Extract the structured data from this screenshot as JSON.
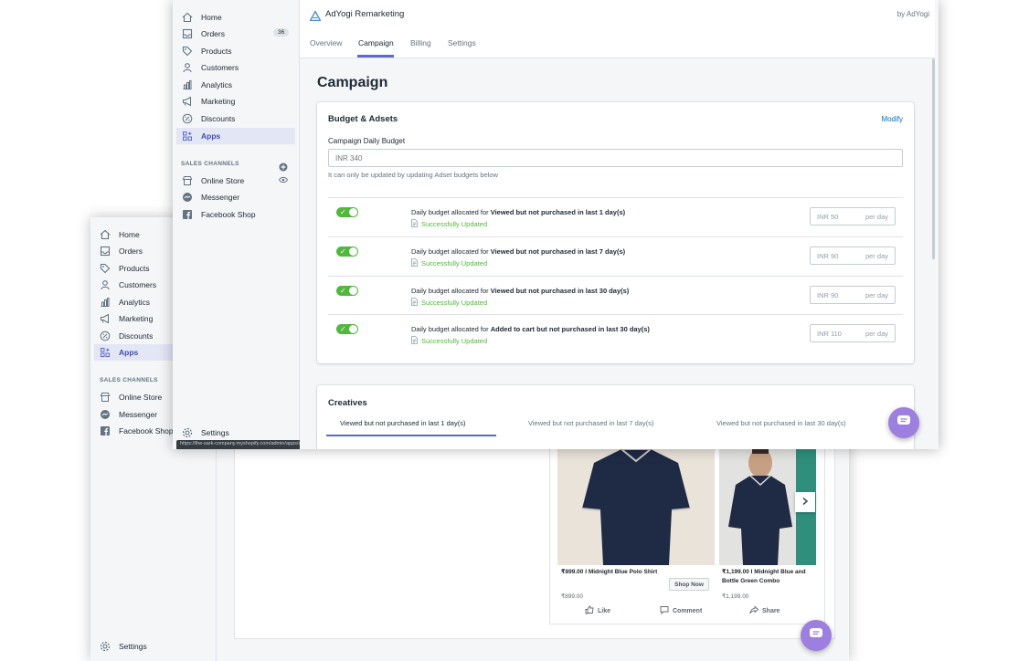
{
  "colors": {
    "accent": "#5c6ac4",
    "toggle_on": "#50b83c",
    "chat_fab": "#9d7fe0",
    "link": "#006fbb"
  },
  "back_window": {
    "sidebar": {
      "items": [
        {
          "label": "Home",
          "icon": "home-icon"
        },
        {
          "label": "Orders",
          "icon": "orders-icon"
        },
        {
          "label": "Products",
          "icon": "tag-icon"
        },
        {
          "label": "Customers",
          "icon": "person-icon"
        },
        {
          "label": "Analytics",
          "icon": "bar-chart-icon"
        },
        {
          "label": "Marketing",
          "icon": "megaphone-icon"
        },
        {
          "label": "Discounts",
          "icon": "discount-icon"
        },
        {
          "label": "Apps",
          "icon": "apps-icon",
          "active": true
        }
      ],
      "sales_channels_label": "SALES CHANNELS",
      "channels": [
        {
          "label": "Online Store",
          "icon": "store-icon"
        },
        {
          "label": "Messenger",
          "icon": "messenger-icon"
        },
        {
          "label": "Facebook Shop",
          "icon": "facebook-icon"
        }
      ],
      "settings_label": "Settings"
    },
    "fb_post": {
      "products": [
        {
          "name": "₹899.00 I Midnight Blue Polo Shirt",
          "price": "₹899.00",
          "cta": "Shop Now"
        },
        {
          "name": "₹1,199.00 I Midnight Blue and Bottle Green Combo",
          "price": "₹1,199.00"
        }
      ],
      "actions": {
        "like": "Like",
        "comment": "Comment",
        "share": "Share"
      }
    }
  },
  "front_window": {
    "sidebar": {
      "items": [
        {
          "label": "Home",
          "icon": "home-icon"
        },
        {
          "label": "Orders",
          "icon": "orders-icon",
          "badge": "36"
        },
        {
          "label": "Products",
          "icon": "tag-icon"
        },
        {
          "label": "Customers",
          "icon": "person-icon"
        },
        {
          "label": "Analytics",
          "icon": "bar-chart-icon"
        },
        {
          "label": "Marketing",
          "icon": "megaphone-icon"
        },
        {
          "label": "Discounts",
          "icon": "discount-icon"
        },
        {
          "label": "Apps",
          "icon": "apps-icon",
          "active": true
        }
      ],
      "sales_channels_label": "SALES CHANNELS",
      "channels": [
        {
          "label": "Online Store",
          "icon": "store-icon"
        },
        {
          "label": "Messenger",
          "icon": "messenger-icon"
        },
        {
          "label": "Facebook Shop",
          "icon": "facebook-icon"
        }
      ],
      "settings_label": "Settings"
    },
    "header": {
      "app_name": "AdYogi Remarketing",
      "by_line": "by AdYogi",
      "tabs": [
        "Overview",
        "Campaign",
        "Billing",
        "Settings"
      ],
      "active_tab": "Campaign"
    },
    "page_title": "Campaign",
    "budget_card": {
      "title": "Budget & Adsets",
      "modify_label": "Modify",
      "daily_budget_label": "Campaign Daily Budget",
      "daily_budget_placeholder": "INR 340",
      "help_text": "It can only be updated by updating Adset budgets below",
      "rows": [
        {
          "prefix": "Daily budget allocated for ",
          "segment": "Viewed but not purchased in last 1 day(s)",
          "status": "Successfully Updated",
          "amount": "INR 50",
          "suffix": "per day",
          "enabled": true
        },
        {
          "prefix": "Daily budget allocated for ",
          "segment": "Viewed but not purchased in last 7 day(s)",
          "status": "Successfully Updated",
          "amount": "INR 90",
          "suffix": "per day",
          "enabled": true
        },
        {
          "prefix": "Daily budget allocated for ",
          "segment": "Viewed but not purchased in last 30 day(s)",
          "status": "Successfully Updated",
          "amount": "INR 90",
          "suffix": "per day",
          "enabled": true
        },
        {
          "prefix": "Daily budget allocated for ",
          "segment": "Added to cart but not purchased in last 30 day(s)",
          "status": "Successfully Updated",
          "amount": "INR 110",
          "suffix": "per day",
          "enabled": true
        }
      ]
    },
    "creatives_card": {
      "title": "Creatives",
      "tabs": [
        "Viewed but not purchased in last 1 day(s)",
        "Viewed but not purchased in last 7 day(s)",
        "Viewed but not purchased in last 30 day(s)"
      ]
    },
    "status_url": "https://the-sark-company.myshopify.com/admin/apps/adyogi-remarketing/campaign"
  }
}
